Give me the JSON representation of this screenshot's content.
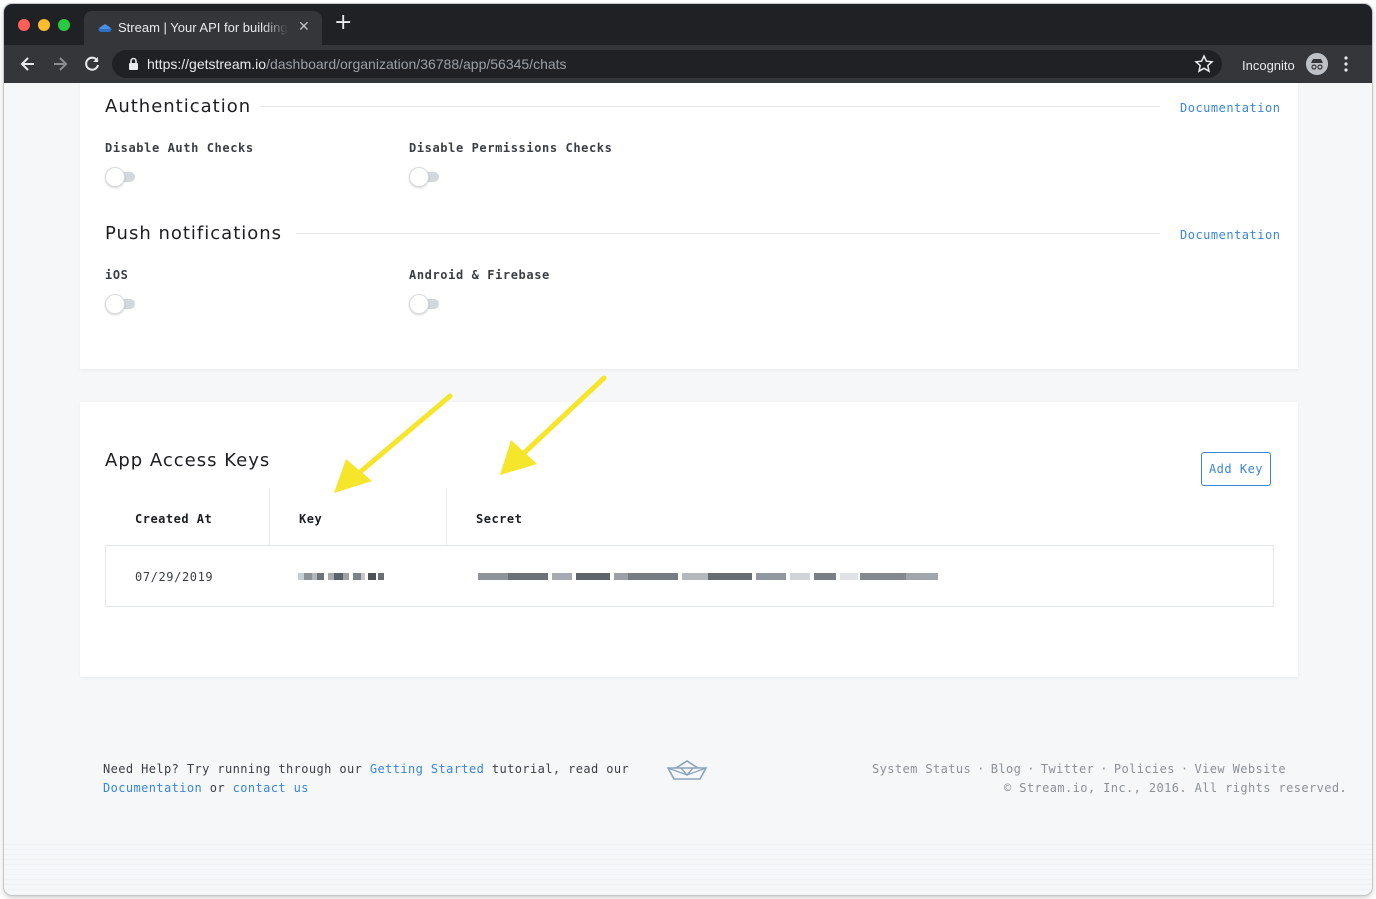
{
  "browser": {
    "tab_title": "Stream | Your API for building a",
    "url_scheme": "https://",
    "url_host": "getstream.io",
    "url_path": "/dashboard/organization/36788/app/56345/chats",
    "incognito_label": "Incognito",
    "new_tab_label": "+",
    "close_tab_label": "✕"
  },
  "authentication": {
    "title": "Authentication",
    "doc_link": "Documentation",
    "disable_auth_checks_label": "Disable Auth Checks",
    "disable_permissions_checks_label": "Disable Permissions Checks",
    "disable_auth_checks_on": false,
    "disable_permissions_checks_on": false
  },
  "push_notifications": {
    "title": "Push notifications",
    "doc_link": "Documentation",
    "ios_label": "iOS",
    "android_label": "Android & Firebase",
    "ios_on": false,
    "android_on": false
  },
  "access_keys": {
    "title": "App Access Keys",
    "add_key_label": "Add Key",
    "columns": [
      "Created At",
      "Key",
      "Secret"
    ],
    "rows": [
      {
        "created_at": "07/29/2019",
        "key": "[redacted]",
        "secret": "[redacted]"
      }
    ]
  },
  "footer": {
    "help_prefix": "Need Help?",
    "help_text1": " Try running through our ",
    "getting_started": "Getting Started",
    "help_text2": " tutorial, read our",
    "documentation": "Documentation",
    "or": " or ",
    "contact_us": "contact us",
    "links": [
      "System Status",
      "Blog",
      "Twitter",
      "Policies",
      "View Website"
    ],
    "separator": "·",
    "copyright": "© Stream.io, Inc., 2016. All rights reserved."
  },
  "colors": {
    "accent": "#3a86d9",
    "annotation_arrow": "#f5e52b",
    "chrome_dark": "#202124"
  }
}
